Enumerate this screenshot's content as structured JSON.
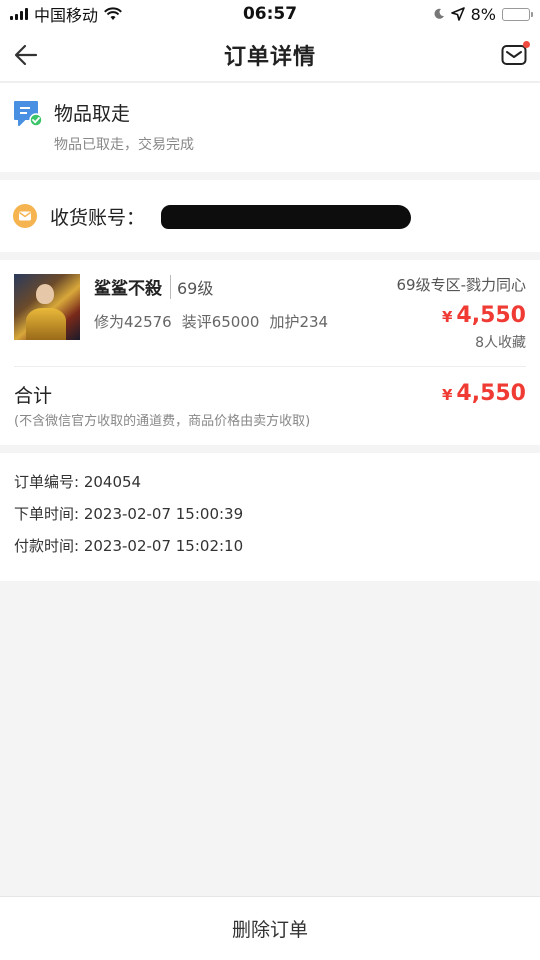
{
  "status_bar": {
    "carrier": "中国移动",
    "time": "06:57",
    "battery": "8%"
  },
  "nav": {
    "title": "订单详情"
  },
  "order_status": {
    "title": "物品取走",
    "subtitle": "物品已取走，交易完成"
  },
  "account": {
    "label": "收货账号："
  },
  "item": {
    "name": "鲨鲨不殺",
    "level": "69级",
    "stats": [
      "修为42576",
      "装评65000",
      "加护234"
    ],
    "zone": "69级专区-戮力同心",
    "currency": "¥",
    "price": "4,550",
    "favorites": "8人收藏"
  },
  "total": {
    "label": "合计",
    "note": "(不含微信官方收取的通道费，商品价格由卖方收取)",
    "currency": "¥",
    "amount": "4,550"
  },
  "info": {
    "order_no": "订单编号: 204054",
    "order_time": "下单时间: 2023-02-07 15:00:39",
    "pay_time": "付款时间: 2023-02-07 15:02:10"
  },
  "actions": {
    "delete": "删除订单"
  },
  "colors": {
    "price_red": "#ef3b33",
    "status_icon_blue": "#4a90e2",
    "status_check_green": "#3cc46a",
    "account_icon_orange": "#f5b450"
  }
}
